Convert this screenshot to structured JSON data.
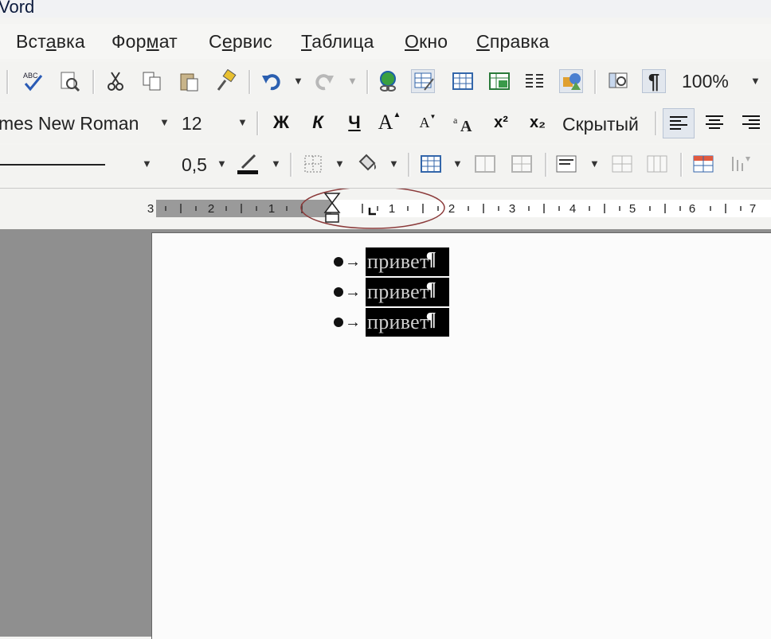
{
  "app": {
    "title_fragment": "Vord"
  },
  "menu": {
    "items": [
      {
        "label_pre": "Вст",
        "label_ul": "а",
        "label_post": "вка"
      },
      {
        "label_pre": "Фор",
        "label_ul": "м",
        "label_post": "ат"
      },
      {
        "label_pre": "С",
        "label_ul": "е",
        "label_post": "рвис"
      },
      {
        "label_pre": "",
        "label_ul": "Т",
        "label_post": "аблица"
      },
      {
        "label_pre": "",
        "label_ul": "О",
        "label_post": "кно"
      },
      {
        "label_pre": "",
        "label_ul": "С",
        "label_post": "правка"
      }
    ]
  },
  "standard_toolbar": {
    "zoom": "100%",
    "icons": [
      "spelling-icon",
      "research-icon",
      "cut-icon",
      "copy-icon",
      "paste-icon",
      "format-painter-icon",
      "undo-icon",
      "redo-icon",
      "hyperlink-icon",
      "tables-borders-icon",
      "insert-table-icon",
      "insert-excel-icon",
      "columns-icon",
      "drawing-icon",
      "document-map-icon",
      "show-formatting-icon"
    ],
    "pilcrow": "¶",
    "spell_text": "ABC"
  },
  "format_toolbar": {
    "font_name": "mes New Roman",
    "font_size": "12",
    "bold": "Ж",
    "italic": "К",
    "underline": "Ч",
    "grow": "A",
    "shrink": "A",
    "superscript": "x²",
    "subscript": "x₂",
    "hidden": "Скрытый"
  },
  "tables_toolbar": {
    "line_weight": "0,5"
  },
  "ruler": {
    "labels": [
      "3",
      "2",
      "1",
      "1",
      "2",
      "3",
      "4",
      "5",
      "6",
      "7"
    ]
  },
  "document": {
    "lines": [
      {
        "text": "привет"
      },
      {
        "text": "привет"
      },
      {
        "text": "привет"
      }
    ],
    "pilcrow": "¶",
    "tab_arrow": "→"
  },
  "colors": {
    "annotation_circle": "#8b3a3a",
    "selection_bg": "#000000",
    "workspace": "#8f8f8f"
  }
}
